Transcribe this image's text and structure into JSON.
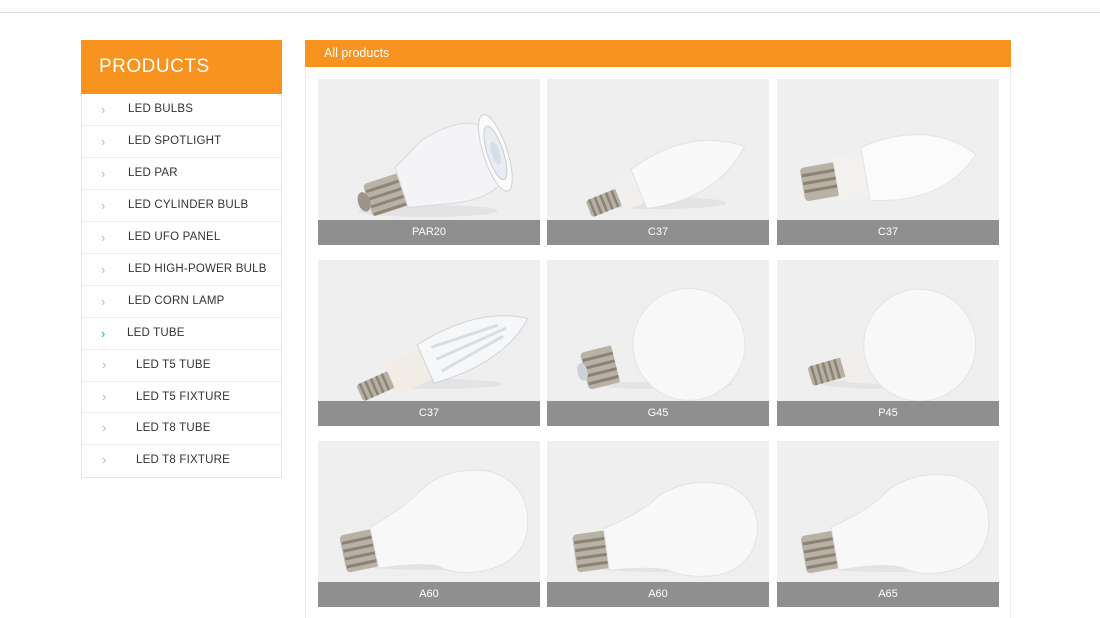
{
  "sidebar": {
    "title": "PRODUCTS",
    "items": [
      {
        "label": "LED BULBS",
        "icon": "chevron-right-icon"
      },
      {
        "label": "LED SPOTLIGHT",
        "icon": "chevron-right-icon"
      },
      {
        "label": "LED PAR",
        "icon": "chevron-right-icon"
      },
      {
        "label": "LED CYLINDER BULB",
        "icon": "chevron-right-icon"
      },
      {
        "label": "LED UFO PANEL",
        "icon": "chevron-right-icon"
      },
      {
        "label": "LED HIGH-POWER BULB",
        "icon": "chevron-right-icon"
      },
      {
        "label": "LED CORN LAMP",
        "icon": "chevron-right-icon"
      },
      {
        "label": "LED TUBE",
        "icon": "chevron-right-icon",
        "active": true
      }
    ],
    "subitems": [
      {
        "label": "LED T5 TUBE"
      },
      {
        "label": "LED T5 FIXTURE"
      },
      {
        "label": "LED T8 TUBE"
      },
      {
        "label": "LED T8 FIXTURE"
      }
    ]
  },
  "main": {
    "title": "All products",
    "products": [
      {
        "name": "PAR20",
        "image": "par20-spotlight-image"
      },
      {
        "name": "C37",
        "image": "candle-bulb-image"
      },
      {
        "name": "C37",
        "image": "candle-bulb-image"
      },
      {
        "name": "C37",
        "image": "candle-bulb-clear-image"
      },
      {
        "name": "G45",
        "image": "globe-bulb-image"
      },
      {
        "name": "P45",
        "image": "globe-bulb-image"
      },
      {
        "name": "A60",
        "image": "a-shape-bulb-image"
      },
      {
        "name": "A60",
        "image": "a-shape-bulb-image"
      },
      {
        "name": "A65",
        "image": "a-shape-bulb-image"
      }
    ]
  },
  "colors": {
    "accent": "#f7931e",
    "caption_bg": "#8f8f8f",
    "card_bg": "#efeff0",
    "active_chevron": "#2aa6a0"
  }
}
